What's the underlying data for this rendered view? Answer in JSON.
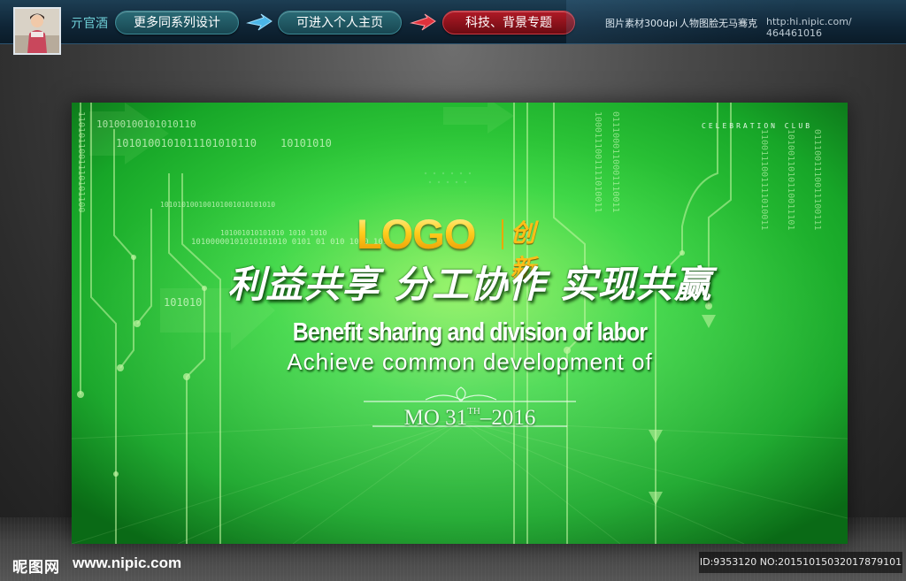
{
  "header": {
    "author": "亓官酒",
    "buttons": [
      {
        "label": "更多同系列设计"
      },
      {
        "label": "可进入个人主页"
      },
      {
        "label": "科技、背景专题"
      }
    ],
    "info_resolution": "图片素材300dpi",
    "info_model": "人物图脸无马骞克",
    "site_url": "http:hi.nipic.com/ 464461016"
  },
  "banner": {
    "club_label": "CELEBRATION CLUB",
    "logo": "LOGO",
    "logo_seal": "创新",
    "headline_cn": "利益共享 分工协作 实现共赢",
    "headline_en_1": "Benefit sharing and division of labor",
    "headline_en_2": "Achieve common development of",
    "date": {
      "prefix": "MO 31",
      "suffix": "TH",
      "year": "2016"
    },
    "binary_lines": [
      "10100100101010110",
      "1010100101011101010110",
      "10101010",
      "101010100100101001010101010",
      "101001010101010 1010 1010",
      "10100000101010101010 0101 01 010 1010 101",
      "101010"
    ],
    "binary_columns": [
      "1000111001111010011",
      "0111000110001110011",
      "1100111001111010011",
      "1010011010110011101",
      "0111001110011100111",
      "1101011001110101100"
    ],
    "colors": {
      "bg_light": "#3fe05a",
      "bg_dark": "#0b6a18",
      "circuit": "#b8f59a",
      "logo_gold": "#ffcc22"
    }
  },
  "footer": {
    "brand": "昵图网",
    "url": "www.nipic.com",
    "id_text": "ID:9353120 NO:20151015032017879101"
  },
  "icons": [
    "avatar-photo",
    "blue-arrow-icon",
    "red-arrow-icon"
  ]
}
